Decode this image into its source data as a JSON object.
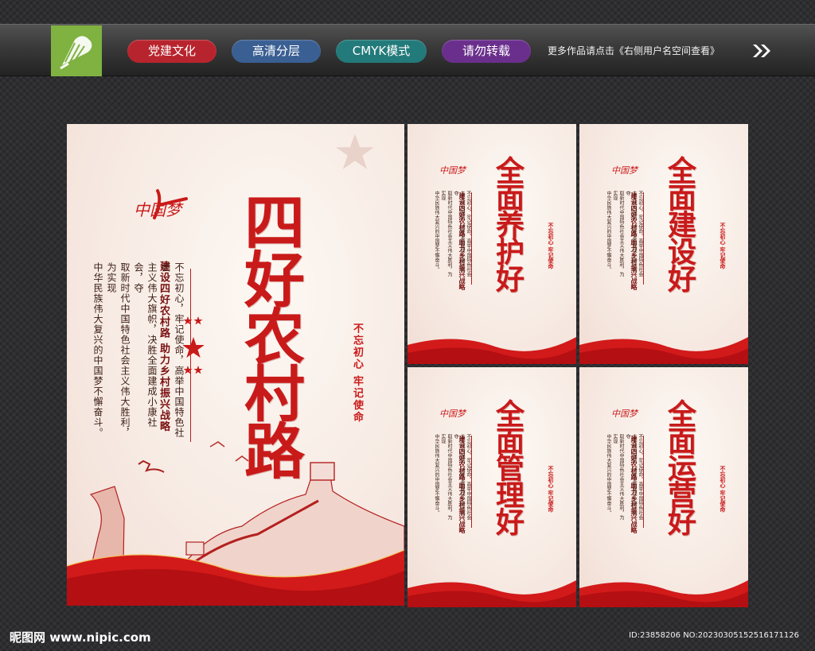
{
  "header": {
    "tags": [
      {
        "label": "党建文化",
        "color": "#b8242d"
      },
      {
        "label": "高清分层",
        "color": "#3a5f93"
      },
      {
        "label": "CMYK模式",
        "color": "#237a7a"
      },
      {
        "label": "请勿转载",
        "color": "#6a2f8c"
      }
    ],
    "note": "更多作品请点击《右侧用户名空间查看》",
    "logo_icon": "nipic-logo-icon",
    "arrow_icon": "double-chevron-right-icon"
  },
  "colors": {
    "accent_red": "#c91a1a",
    "text_dark": "#3a1d14",
    "logo_green": "#7fb241"
  },
  "main_poster": {
    "dream_logo": "中国梦",
    "title": "四好农村路",
    "subtitle": "建设四好农村路 助力乡村振兴战略",
    "body_lines": [
      "不忘初心，牢记使命，高举中国特色社会",
      "主义伟大旗帜，决胜全面建成小康社会，夺",
      "取新时代中国特色社会主义伟大胜利，为实现",
      "中华民族伟大复兴的中国梦不懈奋斗。"
    ],
    "slogan": "不忘初心 牢记使命"
  },
  "small_posters": [
    {
      "title": "全面养护好",
      "dream_logo": "中国梦",
      "subtitle": "建设四好农村路 助力乡村振兴战略",
      "body_lines": [
        "不忘初心，牢记使命，高举中国特色社会",
        "主义伟大旗帜，决胜全面建成小康社会，夺",
        "取新时代中国特色社会主义伟大胜利，为实现",
        "中华民族伟大复兴的中国梦不懈奋斗。"
      ],
      "slogan": "不忘初心 牢记使命"
    },
    {
      "title": "全面建设好",
      "dream_logo": "中国梦",
      "subtitle": "建设四好农村路 助力乡村振兴战略",
      "body_lines": [
        "不忘初心，牢记使命，高举中国特色社会",
        "主义伟大旗帜，决胜全面建成小康社会，夺",
        "取新时代中国特色社会主义伟大胜利，为实现",
        "中华民族伟大复兴的中国梦不懈奋斗。"
      ],
      "slogan": "不忘初心 牢记使命"
    },
    {
      "title": "全面管理好",
      "dream_logo": "中国梦",
      "subtitle": "建设四好农村路 助力乡村振兴战略",
      "body_lines": [
        "不忘初心，牢记使命，高举中国特色社会",
        "主义伟大旗帜，决胜全面建成小康社会，夺",
        "取新时代中国特色社会主义伟大胜利，为实现",
        "中华民族伟大复兴的中国梦不懈奋斗。"
      ],
      "slogan": "不忘初心 牢记使命"
    },
    {
      "title": "全面运营好",
      "dream_logo": "中国梦",
      "subtitle": "建设四好农村路 助力乡村振兴战略",
      "body_lines": [
        "不忘初心，牢记使命，高举中国特色社会",
        "主义伟大旗帜，决胜全面建成小康社会，夺",
        "取新时代中国特色社会主义伟大胜利，为实现",
        "中华民族伟大复兴的中国梦不懈奋斗。"
      ],
      "slogan": "不忘初心 牢记使命"
    }
  ],
  "footer": {
    "site_mark": "昵图网 www.nipic.com",
    "id_text": "ID:23858206 NO:20230305152516171126"
  }
}
